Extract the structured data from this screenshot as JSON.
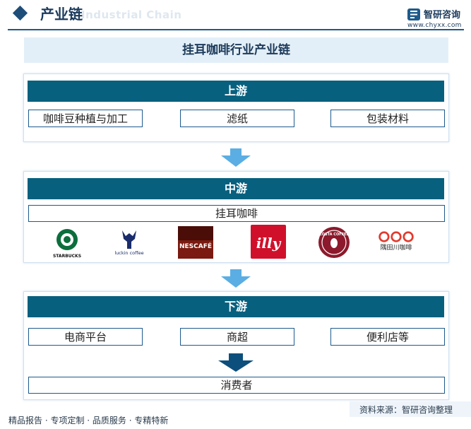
{
  "header": {
    "title": "产业链",
    "watermark": "Industrial Chain",
    "brand": "智研咨询",
    "url": "www.chyxx.com"
  },
  "main_title": "挂耳咖啡行业产业链",
  "upstream": {
    "label": "上游",
    "items": [
      "咖啡豆种植与加工",
      "滤纸",
      "包装材料"
    ]
  },
  "midstream": {
    "label": "中游",
    "product": "挂耳咖啡",
    "brands": [
      {
        "icon": "starbucks-logo",
        "text": "STARBUCKS"
      },
      {
        "icon": "luckin-coffee-logo",
        "text": "luckin coffee"
      },
      {
        "icon": "nescafe-logo",
        "text": "NESCAFÉ"
      },
      {
        "icon": "illy-logo",
        "text": "illy"
      },
      {
        "icon": "costa-coffee-logo",
        "text": "COSTA COFFEE"
      },
      {
        "icon": "saturnbird-logo",
        "text": "隅田川咖啡"
      }
    ]
  },
  "downstream": {
    "label": "下游",
    "items": [
      "电商平台",
      "商超",
      "便利店等"
    ],
    "consumer": "消费者"
  },
  "footer": {
    "left": "精品报告 · 专项定制 · 品质服务 · 专精特新",
    "source": "资料来源：智研咨询整理"
  },
  "colors": {
    "band": "#08607f",
    "box_border": "#1d5a8c",
    "arrow_light": "#4aa3dd",
    "arrow_dark": "#0d4f7c"
  }
}
